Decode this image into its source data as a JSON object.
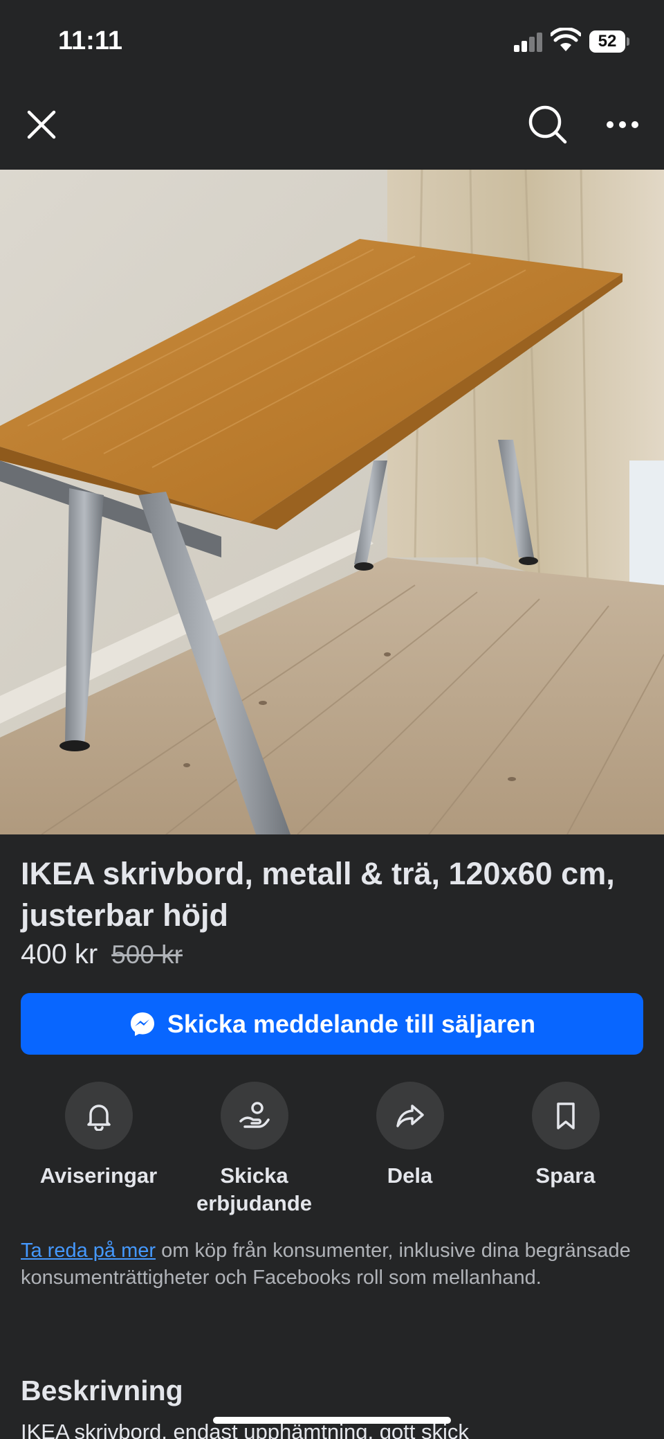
{
  "status_bar": {
    "time": "11:11",
    "battery": "52"
  },
  "nav": {
    "close_icon": "close-icon",
    "search_icon": "search-icon",
    "more_icon": "more-icon"
  },
  "listing": {
    "title": "IKEA skrivbord, metall & trä, 120x60 cm, justerbar höjd",
    "price": "400 kr",
    "original_price": "500 kr"
  },
  "message_button": {
    "label": "Skicka meddelande till säljaren",
    "icon": "messenger-icon"
  },
  "actions": [
    {
      "label": "Aviseringar",
      "icon": "bell-icon"
    },
    {
      "label": "Skicka erbjudande",
      "icon": "offer-icon"
    },
    {
      "label": "Dela",
      "icon": "share-icon"
    },
    {
      "label": "Spara",
      "icon": "bookmark-icon"
    }
  ],
  "info": {
    "link": "Ta reda på mer",
    "text": " om köp från konsumenter, inklusive dina begränsade konsumenträttigheter och Facebooks roll som mellanhand."
  },
  "description": {
    "heading": "Beskrivning",
    "text": "IKEA skrivbord, endast upphämtning, gott skick"
  },
  "colors": {
    "background": "#242526",
    "primary_button": "#0866FF",
    "link": "#4599FF",
    "secondary_text": "#B0B3B8"
  }
}
